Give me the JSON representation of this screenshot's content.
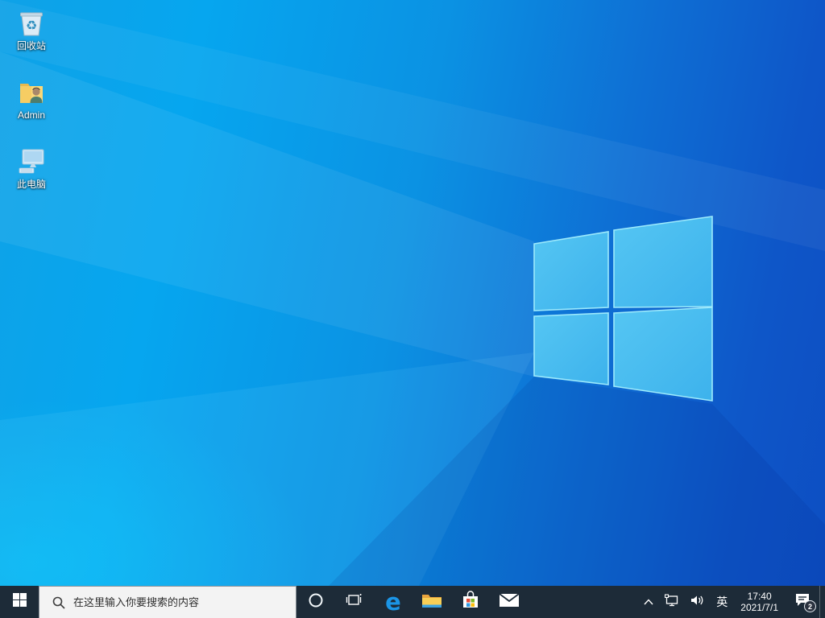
{
  "desktop": {
    "icons": [
      {
        "id": "recycle-bin",
        "label": "回收站"
      },
      {
        "id": "admin-folder",
        "label": "Admin"
      },
      {
        "id": "this-pc",
        "label": "此电脑"
      }
    ]
  },
  "taskbar": {
    "search": {
      "placeholder": "在这里输入你要搜索的内容"
    },
    "buttons": [
      "start",
      "search",
      "cortana",
      "task-view",
      "edge",
      "file-explorer",
      "store",
      "mail"
    ],
    "tray": {
      "items": [
        "hidden-icons-chevron",
        "network",
        "volume",
        "ime",
        "clock",
        "action-center",
        "show-desktop"
      ],
      "ime_label": "英",
      "time": "17:40",
      "date": "2021/7/1",
      "notification_badge": "2"
    }
  },
  "colors": {
    "taskbar_bg": "#1d2b38",
    "search_box_bg": "#f3f3f3",
    "wallpaper_left": "#06a6ef",
    "wallpaper_right": "#0d4ec2",
    "logo_pane": "#48bff1",
    "logo_edge": "#9deafc",
    "edge_blue": "#1b95e6",
    "folder_yellow": "#f7ce56",
    "store_red": "#e64b38",
    "store_green": "#7db723",
    "store_blue": "#2f9ae3",
    "store_yellow": "#fdbe0c"
  }
}
